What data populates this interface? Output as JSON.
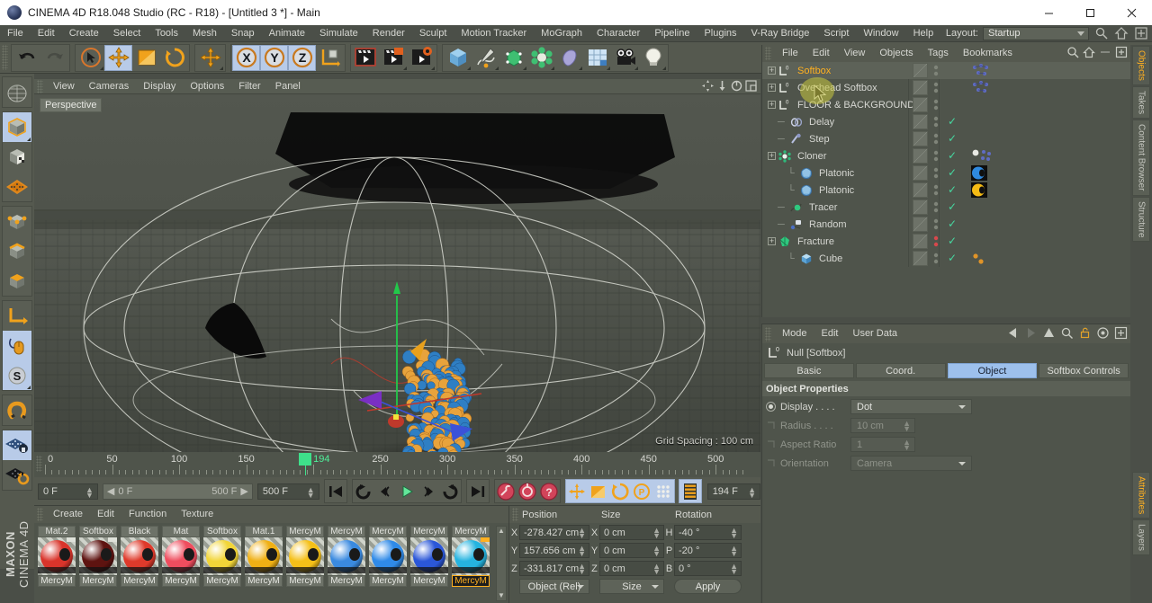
{
  "window": {
    "title": "CINEMA 4D R18.048 Studio (RC - R18) - [Untitled 3 *] - Main",
    "minimize": "minimize-icon",
    "maximize": "maximize-icon",
    "close": "close-icon"
  },
  "menubar": {
    "items": [
      "File",
      "Edit",
      "Create",
      "Select",
      "Tools",
      "Mesh",
      "Snap",
      "Animate",
      "Simulate",
      "Render",
      "Sculpt",
      "Motion Tracker",
      "MoGraph",
      "Character",
      "Pipeline",
      "Plugins",
      "V-Ray Bridge",
      "Script",
      "Window",
      "Help"
    ],
    "layout_label": "Layout:",
    "layout_value": "Startup"
  },
  "viewport": {
    "menu": [
      "View",
      "Cameras",
      "Display",
      "Options",
      "Filter",
      "Panel"
    ],
    "view_tag": "Perspective",
    "grid_spacing": "Grid Spacing : 100 cm"
  },
  "timeline": {
    "labels": [
      "0",
      "50",
      "100",
      "150",
      "250",
      "300",
      "350",
      "400",
      "450",
      "500"
    ],
    "label_values": [
      0,
      50,
      100,
      150,
      250,
      300,
      350,
      400,
      450,
      500
    ],
    "current_frame_marker": "194",
    "range_start": "0 F",
    "range_min": "0 F",
    "range_max": "500 F",
    "range_end": "500 F",
    "current_frame_field": "194 F"
  },
  "materials": {
    "menu": [
      "Create",
      "Edit",
      "Function",
      "Texture"
    ],
    "items": [
      {
        "top": "Mat.2",
        "bottom": "MercyM",
        "color": "#d9342b",
        "selected": false
      },
      {
        "top": "Softbox",
        "bottom": "MercyM",
        "color": "#5e1310",
        "selected": false
      },
      {
        "top": "Black",
        "bottom": "MercyM",
        "color": "#df3a2b",
        "selected": false
      },
      {
        "top": "Mat",
        "bottom": "MercyM",
        "color": "#ef4d5e",
        "selected": false
      },
      {
        "top": "Softbox",
        "bottom": "MercyM",
        "color": "#f2d538",
        "selected": false
      },
      {
        "top": "Mat.1",
        "bottom": "MercyM",
        "color": "#f0b014",
        "selected": false
      },
      {
        "top": "MercyM",
        "bottom": "MercyM",
        "color": "#f5c018",
        "selected": false
      },
      {
        "top": "MercyM",
        "bottom": "MercyM",
        "color": "#3a8ae0",
        "selected": false
      },
      {
        "top": "MercyM",
        "bottom": "MercyM",
        "color": "#2f8ae8",
        "selected": false
      },
      {
        "top": "MercyM",
        "bottom": "MercyM",
        "color": "#2b57d8",
        "selected": false
      },
      {
        "top": "MercyM",
        "bottom": "MercyM",
        "color": "#25b4e0",
        "selected": true
      }
    ]
  },
  "coordinates": {
    "headers": [
      "Position",
      "Size",
      "Rotation"
    ],
    "position": {
      "x": "-278.427 cm",
      "y": "157.656 cm",
      "z": "-331.817 cm"
    },
    "size": {
      "x": "0 cm",
      "y": "0 cm",
      "z": "0 cm"
    },
    "rotation": {
      "h": "-40 °",
      "p": "-20 °",
      "b": "0 °"
    },
    "axis_labels": {
      "p": [
        "X",
        "Y",
        "Z"
      ],
      "s": [
        "X",
        "Y",
        "Z"
      ],
      "r": [
        "H",
        "P",
        "B"
      ]
    },
    "mode_dropdown": "Object (Rel)",
    "size_dropdown": "Size",
    "apply_button": "Apply"
  },
  "object_manager": {
    "menu": [
      "File",
      "Edit",
      "View",
      "Objects",
      "Tags",
      "Bookmarks"
    ],
    "icons": [
      "search-icon",
      "home-icon",
      "minimize-icon",
      "expand-icon"
    ],
    "rows": [
      {
        "label": "Softbox",
        "depth": 0,
        "expandable": true,
        "selected": true,
        "icon": "null-icon",
        "check": false,
        "tagdots": "blue",
        "red": false
      },
      {
        "label": "Overhead Softbox",
        "depth": 0,
        "expandable": true,
        "selected": false,
        "icon": "null-icon",
        "check": false,
        "tagdots": "blue",
        "red": false
      },
      {
        "label": "FLOOR & BACKGROUND",
        "depth": 0,
        "expandable": true,
        "selected": false,
        "icon": "null-icon",
        "check": false,
        "tagdots": "none",
        "red": false
      },
      {
        "label": "Delay",
        "depth": 1,
        "expandable": false,
        "selected": false,
        "icon": "delay-icon",
        "check": true,
        "tagdots": "none",
        "red": false
      },
      {
        "label": "Step",
        "depth": 1,
        "expandable": false,
        "selected": false,
        "icon": "step-icon",
        "check": true,
        "tagdots": "none",
        "red": false
      },
      {
        "label": "Cloner",
        "depth": 0,
        "expandable": true,
        "selected": false,
        "icon": "cloner-icon",
        "check": true,
        "tagdots": "mograph",
        "red": false
      },
      {
        "label": "Platonic",
        "depth": 2,
        "expandable": false,
        "selected": false,
        "icon": "platonic-icon",
        "check": true,
        "tagdots": "matblue",
        "red": false
      },
      {
        "label": "Platonic",
        "depth": 2,
        "expandable": false,
        "selected": false,
        "icon": "platonic-icon",
        "check": true,
        "tagdots": "matyellow",
        "red": false
      },
      {
        "label": "Tracer",
        "depth": 1,
        "expandable": false,
        "selected": false,
        "icon": "tracer-icon",
        "check": true,
        "tagdots": "none",
        "red": false
      },
      {
        "label": "Random",
        "depth": 1,
        "expandable": false,
        "selected": false,
        "icon": "random-icon",
        "check": true,
        "tagdots": "none",
        "red": false
      },
      {
        "label": "Fracture",
        "depth": 0,
        "expandable": true,
        "selected": false,
        "icon": "fracture-icon",
        "check": true,
        "tagdots": "none",
        "red": true
      },
      {
        "label": "Cube",
        "depth": 2,
        "expandable": false,
        "selected": false,
        "icon": "cube-icon",
        "check": true,
        "tagdots": "orange",
        "red": false
      }
    ]
  },
  "attributes": {
    "menu": [
      "Mode",
      "Edit",
      "User Data"
    ],
    "object_title": "Null [Softbox]",
    "tabs": [
      {
        "label": "Basic",
        "active": false
      },
      {
        "label": "Coord.",
        "active": false
      },
      {
        "label": "Object",
        "active": true
      },
      {
        "label": "Softbox Controls",
        "active": false
      }
    ],
    "section_title": "Object Properties",
    "properties": [
      {
        "label": "Display . . . .",
        "type": "dropdown",
        "value": "Dot",
        "enabled": true
      },
      {
        "label": "Radius . . . .",
        "type": "number",
        "value": "10 cm",
        "enabled": false
      },
      {
        "label": "Aspect Ratio",
        "type": "number",
        "value": "1",
        "enabled": false
      },
      {
        "label": "Orientation",
        "type": "dropdown",
        "value": "Camera",
        "enabled": false
      }
    ]
  },
  "vertical_tabs_top": [
    {
      "label": "Objects",
      "active": true
    },
    {
      "label": "Takes",
      "active": false
    },
    {
      "label": "Content Browser",
      "active": false
    },
    {
      "label": "Structure",
      "active": false
    }
  ],
  "vertical_tabs_bottom": [
    {
      "label": "Attributes",
      "active": true
    },
    {
      "label": "Layers",
      "active": false
    }
  ],
  "branding": {
    "maxon": "MAXON",
    "product": "CINEMA 4D"
  },
  "colors": {
    "accent_orange": "#ffb020",
    "accent_blue": "#9dc0ec",
    "panel_bg": "#4f544b",
    "toolbar_bg": "#55594f",
    "green_marker": "#3ee08a"
  }
}
